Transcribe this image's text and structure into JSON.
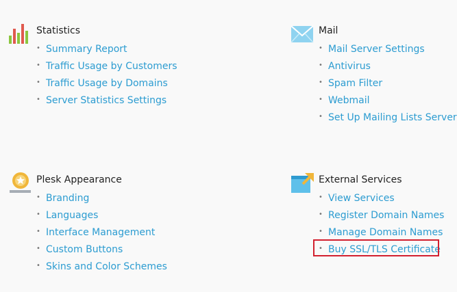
{
  "sections": [
    {
      "title": "Statistics",
      "icon": "bar-chart-icon",
      "links": [
        "Summary Report",
        "Traffic Usage by Customers",
        "Traffic Usage by Domains",
        "Server Statistics Settings"
      ]
    },
    {
      "title": "Mail",
      "icon": "envelope-icon",
      "links": [
        "Mail Server Settings",
        "Antivirus",
        "Spam Filter",
        "Webmail",
        "Set Up Mailing Lists Server"
      ]
    },
    {
      "title": "Plesk Appearance",
      "icon": "badge-star-icon",
      "links": [
        "Branding",
        "Languages",
        "Interface Management",
        "Custom Buttons",
        "Skins and Color Schemes"
      ]
    },
    {
      "title": "External Services",
      "icon": "external-window-icon",
      "links": [
        "View Services",
        "Register Domain Names",
        "Manage Domain Names",
        "Buy SSL/TLS Certificate"
      ]
    }
  ],
  "highlighted_link": "Buy SSL/TLS Certificate",
  "colors": {
    "link": "#2c9cd1",
    "highlight": "#d21f2e",
    "background": "#f9f9f9"
  }
}
